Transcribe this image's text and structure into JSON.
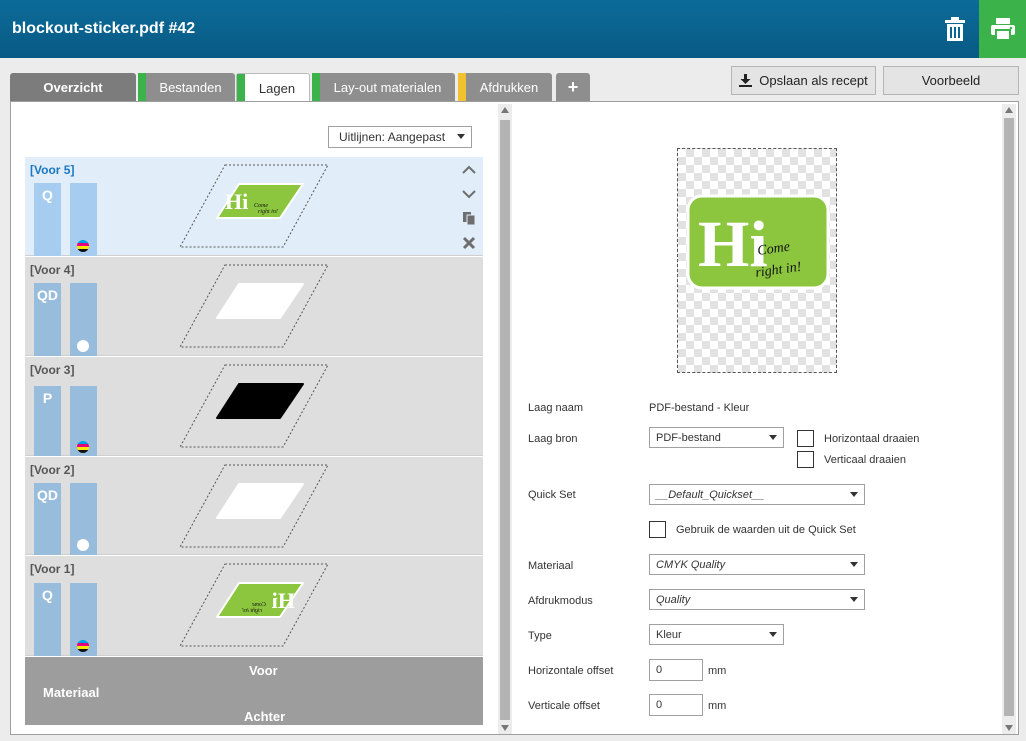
{
  "window": {
    "title": "blockout-sticker.pdf #42"
  },
  "tabs": [
    {
      "label": "Overzicht"
    },
    {
      "label": "Bestanden"
    },
    {
      "label": "Lagen"
    },
    {
      "label": "Lay-out materialen"
    },
    {
      "label": "Afdrukken"
    },
    {
      "label": "+"
    }
  ],
  "tab_status_colors": {
    "bestanden": "#3bb34a",
    "lagen": "#3bb34a",
    "layout": "#3bb34a",
    "afdrukken": "#f2c12e"
  },
  "toolbar": {
    "save_recipe": "Opslaan als recept",
    "preview": "Voorbeeld"
  },
  "align_select": {
    "value": "Uitlijnen: Aangepast"
  },
  "layers": [
    {
      "label": "[Voor 5]",
      "mode": "Q",
      "ink": "cmyk",
      "content": "color-logo",
      "selected": true
    },
    {
      "label": "[Voor 4]",
      "mode": "QD",
      "ink": "white",
      "content": "white-blockout"
    },
    {
      "label": "[Voor 3]",
      "mode": "P",
      "ink": "cmyk",
      "content": "black-blockout"
    },
    {
      "label": "[Voor 2]",
      "mode": "QD",
      "ink": "white",
      "content": "white-blockout"
    },
    {
      "label": "[Voor 1]",
      "mode": "Q",
      "ink": "cmyk",
      "content": "mirrored-color-logo"
    }
  ],
  "material_bar": {
    "material": "Materiaal",
    "front": "Voor",
    "back": "Achter"
  },
  "logo": {
    "big": "Hi",
    "small_line1": "Come",
    "small_line2": "right in!"
  },
  "properties": {
    "layer_name_label": "Laag naam",
    "layer_name_value": "PDF-bestand - Kleur",
    "layer_source_label": "Laag bron",
    "layer_source_value": "PDF-bestand",
    "flip_horizontal": "Horizontaal draaien",
    "flip_vertical": "Verticaal draaien",
    "quickset_label": "Quick Set",
    "quickset_value": "__Default_Quickset__",
    "use_quickset": "Gebruik de waarden uit de Quick Set",
    "material_label": "Materiaal",
    "material_value": "CMYK Quality",
    "print_mode_label": "Afdrukmodus",
    "print_mode_value": "Quality",
    "type_label": "Type",
    "type_value": "Kleur",
    "h_offset_label": "Horizontale offset",
    "h_offset_value": "0",
    "v_offset_label": "Verticale offset",
    "v_offset_value": "0",
    "unit": "mm"
  },
  "colors": {
    "header": "#0d6b99",
    "print_button": "#3bb34a",
    "logo_green": "#8cc63f",
    "selected_label": "#1a78c2"
  }
}
